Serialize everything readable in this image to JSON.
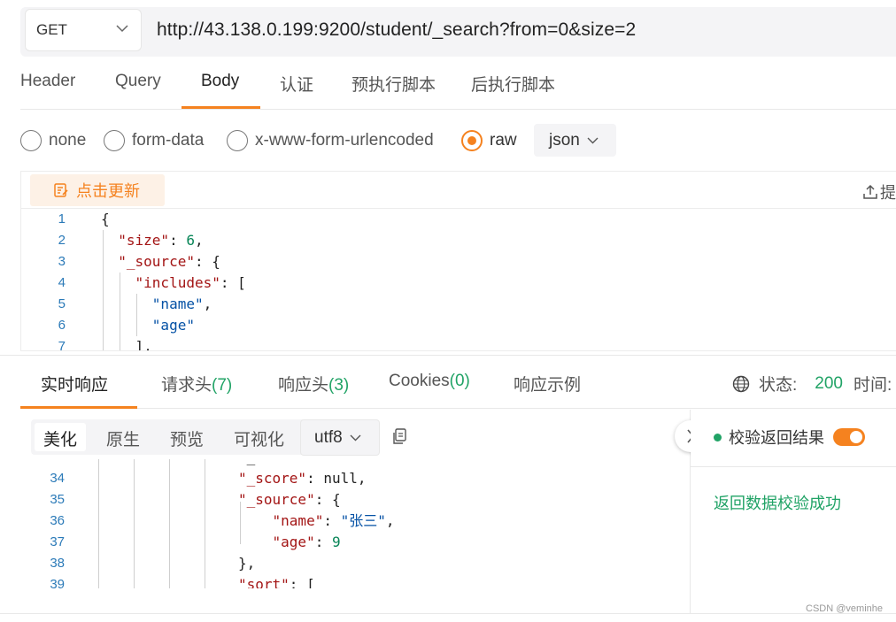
{
  "request": {
    "method": "GET",
    "url": "http://43.138.0.199:9200/student/_search?from=0&size=2"
  },
  "request_tabs": [
    "Header",
    "Query",
    "Body",
    "认证",
    "预执行脚本",
    "后执行脚本"
  ],
  "active_request_tab": "Body",
  "body_types": [
    "none",
    "form-data",
    "x-www-form-urlencoded",
    "raw"
  ],
  "selected_body_type": "raw",
  "body_format": "json",
  "editor": {
    "refresh_label": "点击更新",
    "submit_label": "提",
    "lines": [
      {
        "n": "1",
        "text": "{"
      },
      {
        "n": "2",
        "text": "  \"size\": 6,"
      },
      {
        "n": "3",
        "text": "  \"_source\": {"
      },
      {
        "n": "4",
        "text": "    \"includes\": ["
      },
      {
        "n": "5",
        "text": "      \"name\","
      },
      {
        "n": "6",
        "text": "      \"age\""
      },
      {
        "n": "7",
        "text": "    ],"
      }
    ]
  },
  "response_tabs": {
    "realtime": "实时响应",
    "req_headers": "请求头",
    "req_headers_count": "(7)",
    "resp_headers": "响应头",
    "resp_headers_count": "(3)",
    "cookies": "Cookies",
    "cookies_count": "(0)",
    "example": "响应示例"
  },
  "status": {
    "label": "状态:",
    "code": "200",
    "time_label": "时间:"
  },
  "view_tabs": [
    "美化",
    "原生",
    "预览",
    "可视化"
  ],
  "active_view_tab": "美化",
  "encoding": "utf8",
  "response_lines": [
    {
      "n": "34",
      "text": "\"_score\": null,"
    },
    {
      "n": "35",
      "text": "\"_source\": {"
    },
    {
      "n": "36",
      "text": "    \"name\": \"张三\","
    },
    {
      "n": "37",
      "text": "    \"age\": 9"
    },
    {
      "n": "38",
      "text": "},"
    },
    {
      "n": "39",
      "text": "\"sort\": ["
    }
  ],
  "validation": {
    "label": "校验返回结果",
    "enabled": true,
    "result": "返回数据校验成功"
  },
  "watermark": "CSDN @veminhe",
  "colors": {
    "accent": "#f5821f",
    "success": "#21a366"
  }
}
